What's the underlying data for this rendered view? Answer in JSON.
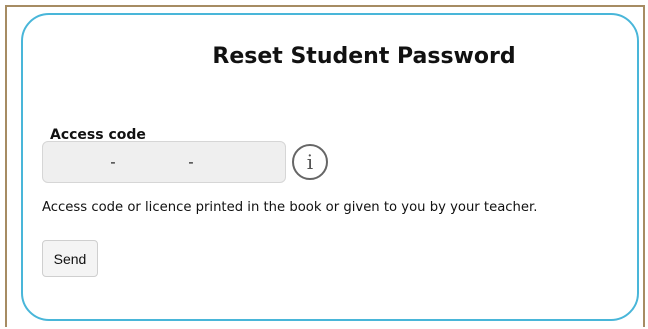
{
  "page": {
    "title": "Reset Student Password"
  },
  "form": {
    "access_code_label": "Access code",
    "access_code_segments": [
      "",
      "",
      ""
    ],
    "access_code_separator": "-",
    "info_icon": "info-icon",
    "help_text": "Access code or licence printed in the book or given to you by your teacher.",
    "send_label": "Send"
  },
  "colors": {
    "card_border": "#49b6d9",
    "frame_border": "#a68c63",
    "input_background": "#efefef"
  }
}
